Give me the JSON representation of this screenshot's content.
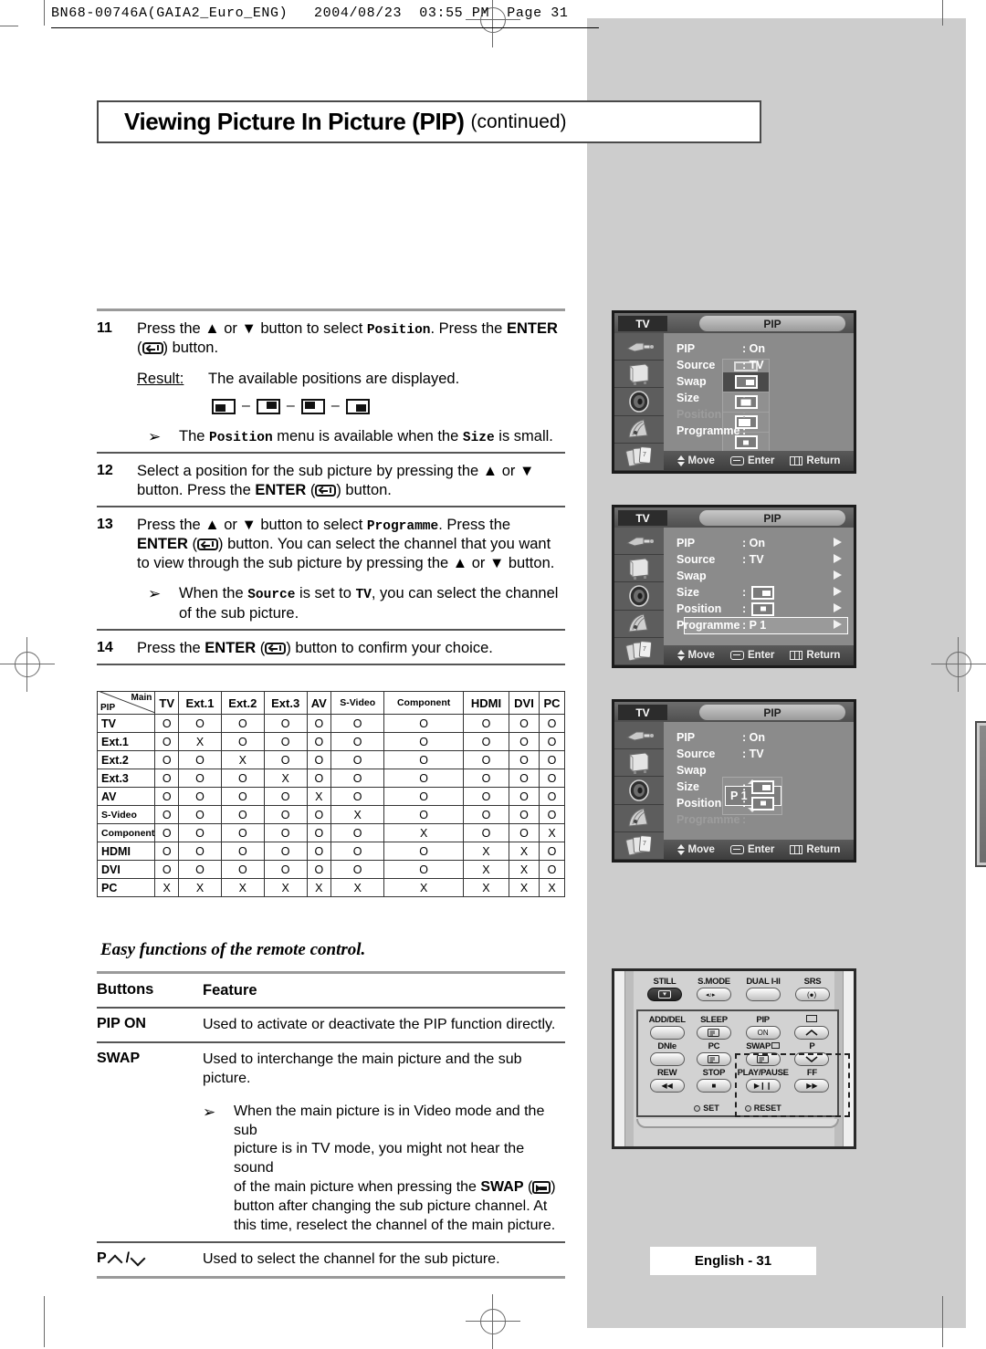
{
  "print_header": "BN68-00746A(GAIA2_Euro_ENG)   2004/08/23  03:55 PM  Page 31",
  "title": {
    "main": "Viewing Picture In Picture (PIP)",
    "continued": "(continued)"
  },
  "steps": [
    {
      "num": "11",
      "text_parts": [
        "Press the ▲ or ▼ button to select ",
        "Position",
        ". Press the ",
        "ENTER",
        " (",
        ") button."
      ],
      "result_label": "Result:",
      "result_text": "The available positions are displayed.",
      "position_icons": [
        "bottom-left",
        "top-right",
        "top-left",
        "bottom-right"
      ],
      "note": [
        "The ",
        "Position",
        " menu is available when the ",
        "Size",
        " is small."
      ]
    },
    {
      "num": "12",
      "text": "Select a position for the sub picture by pressing the ▲ or ▼ button. Press the ENTER (    ) button."
    },
    {
      "num": "13",
      "text": "Press the ▲ or ▼ button to select Programme. Press the ENTER (    ) button. You can select the channel that you want to view through the sub picture by pressing the ▲ or ▼ button.",
      "note": "When the Source is set to TV, you can select the channel of the sub picture."
    },
    {
      "num": "14",
      "text": "Press the ENTER (    ) button to confirm your choice."
    }
  ],
  "compat_table": {
    "corner_row_label": "PIP",
    "corner_col_label": "Main",
    "columns": [
      "TV",
      "Ext.1",
      "Ext.2",
      "Ext.3",
      "AV",
      "S-Video",
      "Component",
      "HDMI",
      "DVI",
      "PC"
    ],
    "rows": [
      {
        "label": "TV",
        "cells": [
          "O",
          "O",
          "O",
          "O",
          "O",
          "O",
          "O",
          "O",
          "O",
          "O"
        ]
      },
      {
        "label": "Ext.1",
        "cells": [
          "O",
          "X",
          "O",
          "O",
          "O",
          "O",
          "O",
          "O",
          "O",
          "O"
        ]
      },
      {
        "label": "Ext.2",
        "cells": [
          "O",
          "O",
          "X",
          "O",
          "O",
          "O",
          "O",
          "O",
          "O",
          "O"
        ]
      },
      {
        "label": "Ext.3",
        "cells": [
          "O",
          "O",
          "O",
          "X",
          "O",
          "O",
          "O",
          "O",
          "O",
          "O"
        ]
      },
      {
        "label": "AV",
        "cells": [
          "O",
          "O",
          "O",
          "O",
          "X",
          "O",
          "O",
          "O",
          "O",
          "O"
        ]
      },
      {
        "label": "S-Video",
        "cells": [
          "O",
          "O",
          "O",
          "O",
          "O",
          "X",
          "O",
          "O",
          "O",
          "O"
        ]
      },
      {
        "label": "Component",
        "cells": [
          "O",
          "O",
          "O",
          "O",
          "O",
          "O",
          "X",
          "O",
          "O",
          "X"
        ]
      },
      {
        "label": "HDMI",
        "cells": [
          "O",
          "O",
          "O",
          "O",
          "O",
          "O",
          "O",
          "X",
          "X",
          "O"
        ]
      },
      {
        "label": "DVI",
        "cells": [
          "O",
          "O",
          "O",
          "O",
          "O",
          "O",
          "O",
          "X",
          "X",
          "O"
        ]
      },
      {
        "label": "PC",
        "cells": [
          "X",
          "X",
          "X",
          "X",
          "X",
          "X",
          "X",
          "X",
          "X",
          "X"
        ]
      }
    ]
  },
  "easy_functions": {
    "title": "Easy functions of the remote control.",
    "head_buttons": "Buttons",
    "head_feature": "Feature",
    "rows": [
      {
        "button": "PIP ON",
        "feature": "Used to activate or deactivate the PIP function directly."
      },
      {
        "button": "SWAP",
        "feature": "Used to interchange the main picture and the sub picture."
      }
    ],
    "swap_note": [
      "When the main picture is in Video mode and the sub",
      "picture is in TV mode, you might not hear the sound",
      "of the main picture when pressing the ",
      "SWAP",
      " (",
      ")",
      "button after changing the sub picture channel. At",
      "this time, reselect the channel of the main picture."
    ],
    "p_row": {
      "button": "P",
      "separator": "/",
      "feature": "Used to select the channel for the sub picture."
    }
  },
  "osd": {
    "tv_label": "TV",
    "tab_label": "PIP",
    "footer": {
      "move": "Move",
      "enter": "Enter",
      "return": "Return"
    },
    "sidebar_icons": [
      "input-plug-icon",
      "picture-tv-icon",
      "sound-speaker-icon",
      "channel-icon",
      "setup-cards-icon"
    ],
    "screens": [
      {
        "id": "osd-size-open",
        "lines": [
          {
            "name": "PIP",
            "value": ": On",
            "dim": false
          },
          {
            "name": "Source",
            "value": ": TV",
            "dim": false
          },
          {
            "name": "Swap",
            "value": "",
            "dim": false
          },
          {
            "name": "Size",
            "value": ":",
            "dim": false
          },
          {
            "name": "Position",
            "value": ":",
            "dim": true
          },
          {
            "name": "Programme",
            "value": ":",
            "dim": false
          }
        ],
        "size_menu_options": [
          "sz-sm",
          "sz-md",
          "sz-lgr",
          "sz-dot"
        ],
        "size_menu_selected_index": 0,
        "arrows": false
      },
      {
        "id": "osd-programme-selected",
        "lines": [
          {
            "name": "PIP",
            "value": ": On",
            "dim": false
          },
          {
            "name": "Source",
            "value": ": TV",
            "dim": false
          },
          {
            "name": "Swap",
            "value": "",
            "dim": false
          },
          {
            "name": "Size",
            "value": ":",
            "dim": false,
            "icon": "sz-sm"
          },
          {
            "name": "Position",
            "value": ":",
            "dim": false,
            "icon": "sz-dot"
          },
          {
            "name": "Programme",
            "value": ": P 1",
            "dim": false,
            "highlight": true
          }
        ],
        "arrows": true
      },
      {
        "id": "osd-programme-spinner",
        "lines": [
          {
            "name": "PIP",
            "value": ": On",
            "dim": false
          },
          {
            "name": "Source",
            "value": ": TV",
            "dim": false
          },
          {
            "name": "Swap",
            "value": "",
            "dim": false
          },
          {
            "name": "Size",
            "value": ":",
            "dim": false,
            "icon": "sz-sm"
          },
          {
            "name": "Position",
            "value": ":",
            "dim": false,
            "icon": "sz-dot"
          },
          {
            "name": "Programme",
            "value": ":",
            "dim": true
          }
        ],
        "spinner_value": "P 1",
        "arrows": false
      }
    ]
  },
  "remote": {
    "top_row": [
      {
        "label": "STILL",
        "key": "still-icon",
        "dark": true
      },
      {
        "label": "S.MODE",
        "key": "sound-icon",
        "dark": false
      },
      {
        "label": "DUAL I-II",
        "key": "",
        "dark": false
      },
      {
        "label": "SRS",
        "key": "srs-icon",
        "dark": false
      }
    ],
    "grid": [
      {
        "label": "ADD/DEL",
        "key": ""
      },
      {
        "label": "SLEEP",
        "key": "list-icon"
      },
      {
        "label": "PIP",
        "key": "ON"
      },
      {
        "label": "",
        "key": "pip-swap-icon"
      },
      {
        "label": "DNIe",
        "key": ""
      },
      {
        "label": "PC",
        "key": "list-icon"
      },
      {
        "label": "SWAP",
        "key": "list-icon"
      },
      {
        "label": "P",
        "key": "chev-down-icon"
      },
      {
        "label": "REW",
        "key": "◀◀"
      },
      {
        "label": "STOP",
        "key": "■"
      },
      {
        "label": "PLAY/PAUSE",
        "key": "▶❙❙"
      },
      {
        "label": "FF",
        "key": "▶▶"
      }
    ],
    "set_label": "SET",
    "reset_label": "RESET"
  },
  "footer": "English - 31"
}
